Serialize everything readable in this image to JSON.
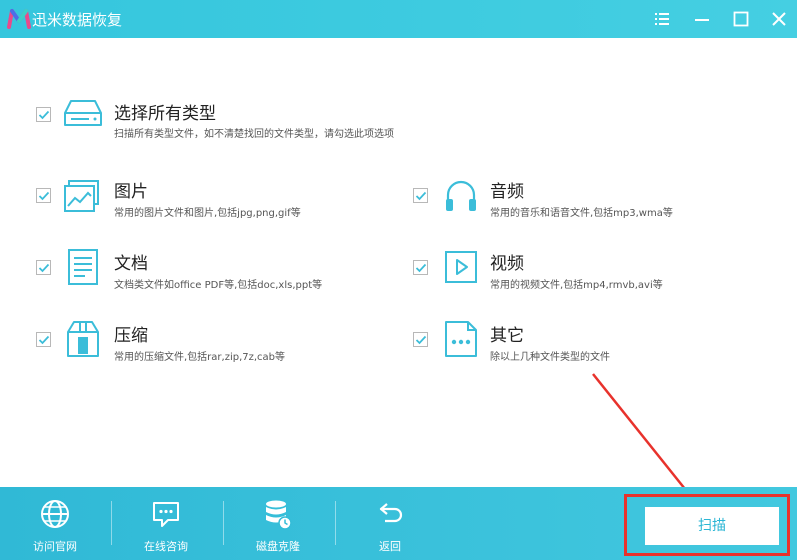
{
  "app": {
    "title": "迅米数据恢复"
  },
  "window_controls": [
    "menu-icon",
    "minimize-icon",
    "maximize-icon",
    "close-icon"
  ],
  "select_all": {
    "title": "选择所有类型",
    "desc": "扫描所有类型文件，如不清楚找回的文件类型，请勾选此项选项",
    "checked": true
  },
  "file_types": {
    "image": {
      "title": "图片",
      "desc": "常用的图片文件和图片,包括jpg,png,gif等",
      "checked": true,
      "icon": "image-icon"
    },
    "audio": {
      "title": "音频",
      "desc": "常用的音乐和语音文件,包括mp3,wma等",
      "checked": true,
      "icon": "headphones-icon"
    },
    "doc": {
      "title": "文档",
      "desc": "文档类文件如office PDF等,包括doc,xls,ppt等",
      "checked": true,
      "icon": "document-icon"
    },
    "video": {
      "title": "视频",
      "desc": "常用的视频文件,包括mp4,rmvb,avi等",
      "checked": true,
      "icon": "video-icon"
    },
    "archive": {
      "title": "压缩",
      "desc": "常用的压缩文件,包括rar,zip,7z,cab等",
      "checked": true,
      "icon": "archive-icon"
    },
    "other": {
      "title": "其它",
      "desc": "除以上几种文件类型的文件",
      "checked": true,
      "icon": "other-file-icon"
    }
  },
  "footer": {
    "buttons": [
      {
        "label": "访问官网",
        "icon": "globe-icon"
      },
      {
        "label": "在线咨询",
        "icon": "chat-icon"
      },
      {
        "label": "磁盘克隆",
        "icon": "disk-clone-icon"
      },
      {
        "label": "返回",
        "icon": "back-arrow-icon"
      }
    ],
    "scan_label": "扫描"
  },
  "colors": {
    "accent": "#3cc8de",
    "footer": "#35bdd8",
    "icon": "#3bbdd9",
    "annotation": "#e8322c"
  }
}
